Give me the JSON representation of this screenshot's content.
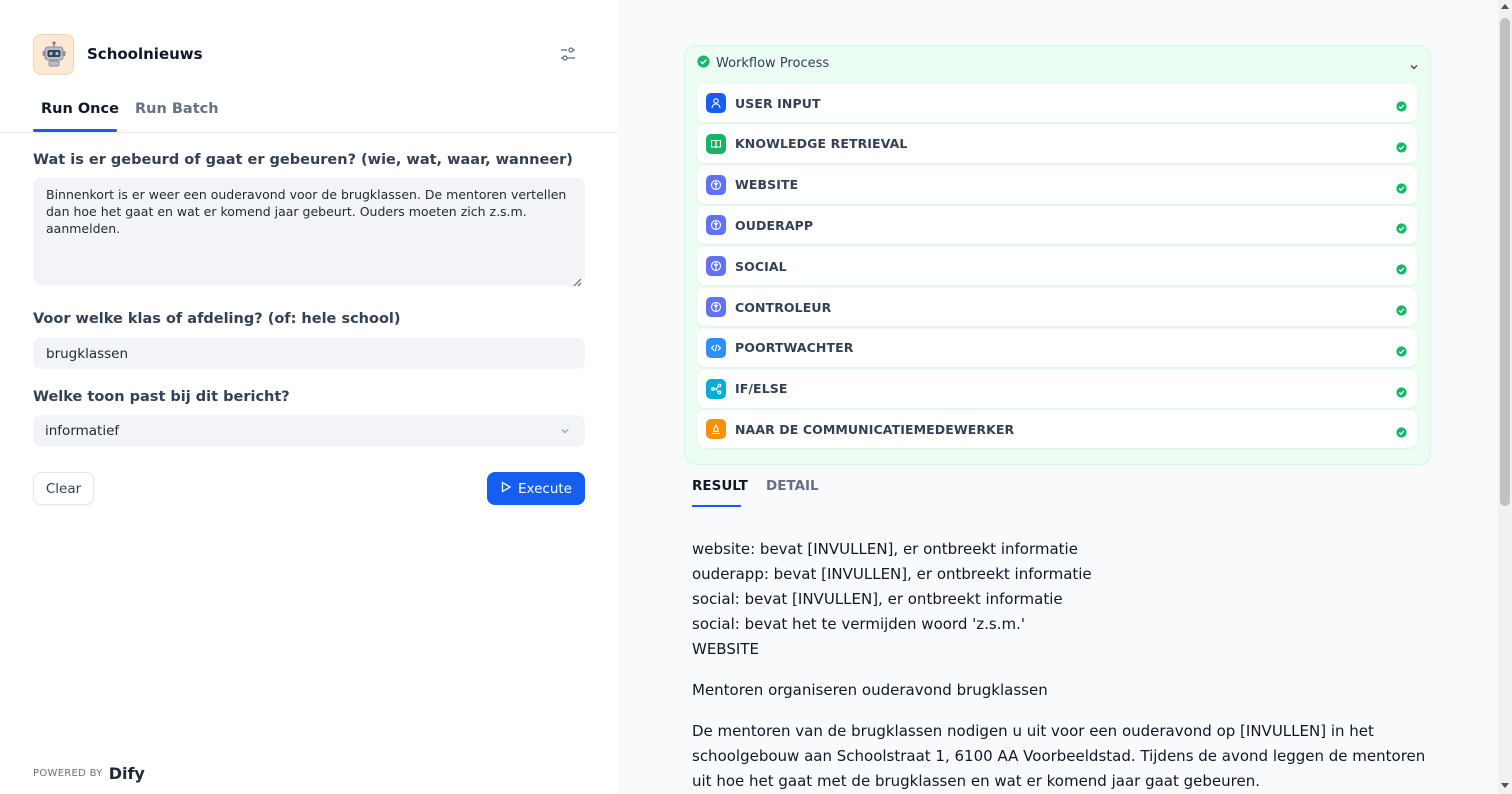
{
  "app": {
    "title": "Schoolnieuws",
    "icon": "robot-icon"
  },
  "tabs": [
    {
      "label": "Run Once"
    },
    {
      "label": "Run Batch"
    }
  ],
  "form": {
    "q1_label": "Wat is er gebeurd of gaat er gebeuren? (wie, wat, waar, wanneer)",
    "q1_value": "Binnenkort is er weer een ouderavond voor de brugklassen. De mentoren vertellen dan hoe het gaat en wat er komend jaar gebeurt. Ouders moeten zich z.s.m. aanmelden.",
    "q2_label": "Voor welke klas of afdeling? (of: hele school)",
    "q2_value": "brugklassen",
    "q3_label": "Welke toon past bij dit bericht?",
    "q3_value": "informatief",
    "clear_label": "Clear",
    "execute_label": "Execute"
  },
  "footer": {
    "powered_by": "POWERED BY",
    "brand": "Dify"
  },
  "workflow": {
    "title": "Workflow Process",
    "steps": [
      {
        "label": "USER INPUT",
        "icon": "user-input-icon",
        "color": "#155eef"
      },
      {
        "label": "KNOWLEDGE RETRIEVAL",
        "icon": "book-icon",
        "color": "#16b364"
      },
      {
        "label": "WEBSITE",
        "icon": "llm-icon",
        "color": "#6172f3"
      },
      {
        "label": "OUDERAPP",
        "icon": "llm-icon",
        "color": "#6172f3"
      },
      {
        "label": "SOCIAL",
        "icon": "llm-icon",
        "color": "#6172f3"
      },
      {
        "label": "CONTROLEUR",
        "icon": "llm-icon",
        "color": "#6172f3"
      },
      {
        "label": "POORTWACHTER",
        "icon": "code-icon",
        "color": "#2e90fa"
      },
      {
        "label": "IF/ELSE",
        "icon": "branch-icon",
        "color": "#06aed4"
      },
      {
        "label": "NAAR DE COMMUNICATIEMEDEWERKER",
        "icon": "answer-icon",
        "color": "#f79009"
      }
    ]
  },
  "result_tabs": [
    {
      "label": "RESULT"
    },
    {
      "label": "DETAIL"
    }
  ],
  "result": {
    "lines": [
      "website: bevat [INVULLEN], er ontbreekt informatie",
      "ouderapp: bevat [INVULLEN], er ontbreekt informatie",
      "social: bevat [INVULLEN], er ontbreekt informatie",
      "social: bevat het te vermijden woord 'z.s.m.'",
      "WEBSITE"
    ],
    "heading": "Mentoren organiseren ouderavond brugklassen",
    "paragraph": "De mentoren van de brugklassen nodigen u uit voor een ouderavond op [INVULLEN] in het schoolgebouw aan Schoolstraat 1, 6100 AA Voorbeeldstad. Tijdens de avond leggen de mentoren uit hoe het gaat met de brugklassen en wat er komend jaar gaat gebeuren."
  },
  "colors": {
    "accent": "#155eef",
    "success": "#12b76a",
    "workflow_bg": "#ecfdf3"
  }
}
